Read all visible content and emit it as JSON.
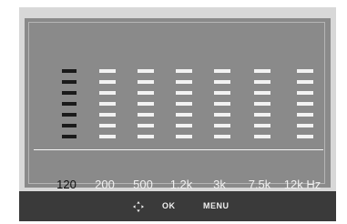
{
  "eq": {
    "bands": [
      {
        "label": "120",
        "active": true
      },
      {
        "label": "200",
        "active": false
      },
      {
        "label": "500",
        "active": false
      },
      {
        "label": "1.2k",
        "active": false
      },
      {
        "label": "3k",
        "active": false
      },
      {
        "label": "7.5k",
        "active": false
      },
      {
        "label": "12k Hz",
        "active": false
      }
    ],
    "segments_per_band": 7
  },
  "footer": {
    "nav_icon": "four-way-arrows-icon",
    "ok_label": "OK",
    "menu_label": "MENU"
  },
  "colors": {
    "active_segment": "#1a1a1a",
    "inactive_segment": "#f2f2f2",
    "panel_bg": "#8a8a8a",
    "footer_bg": "#3a3a3a"
  }
}
